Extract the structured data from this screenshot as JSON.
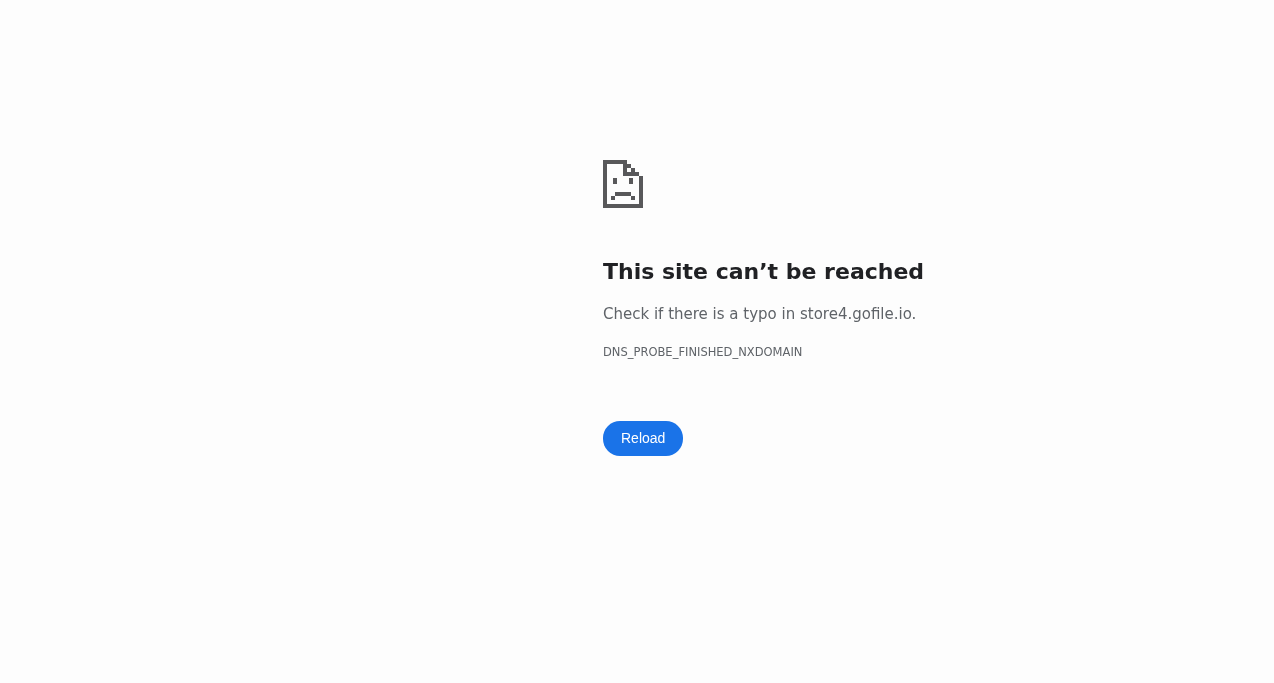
{
  "heading": "This site can’t be reached",
  "message": "Check if there is a typo in store4.gofile.io.",
  "error_code": "DNS_PROBE_FINISHED_NXDOMAIN",
  "buttons": [
    {
      "label": "Reload"
    }
  ]
}
